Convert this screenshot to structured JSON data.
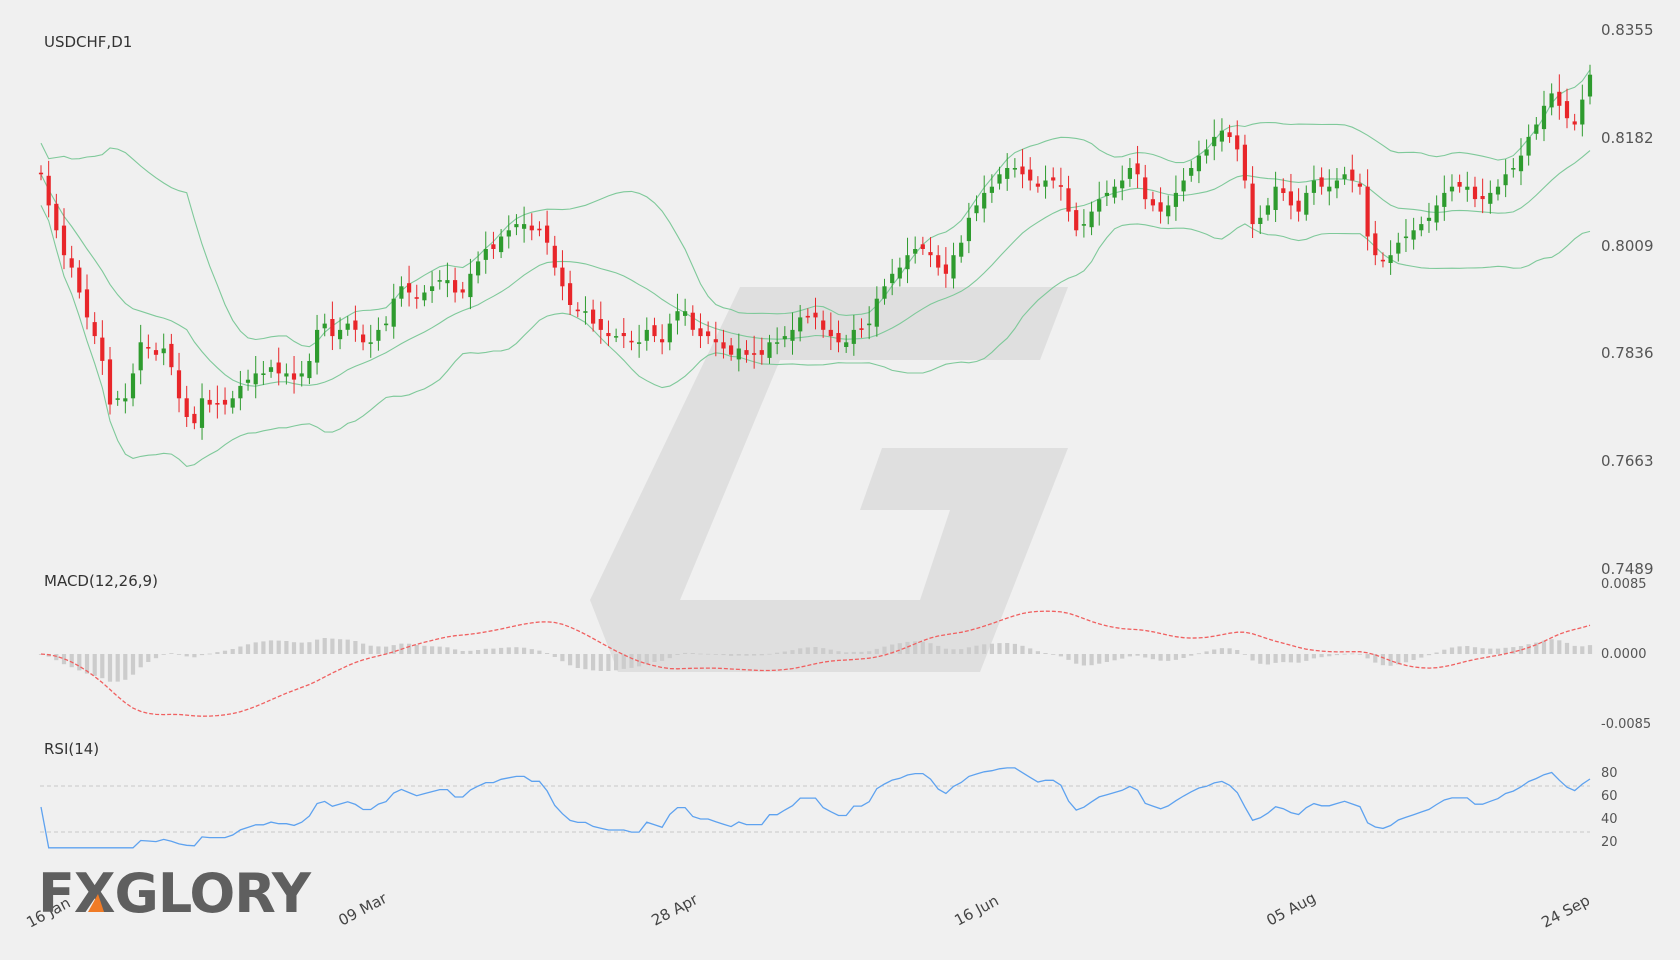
{
  "colors": {
    "bull": "#2e9b2e",
    "bear": "#e8262a",
    "bollinger": "#7fc99a",
    "macd_signal": "#f06060",
    "macd_hist": "#cccccc",
    "rsi": "#5ea2ef",
    "watermark": "#dcdcdc",
    "logo": "#5f5f5f",
    "logo_accent": "#f07b26"
  },
  "main_panel": {
    "title": "USDCHF,D1",
    "price_axis": [
      "0.8355",
      "0.8182",
      "0.8009",
      "0.7836",
      "0.7663",
      "0.7489"
    ],
    "price_range": [
      0.7489,
      0.8355
    ]
  },
  "macd_panel": {
    "title": "MACD(12,26,9)",
    "axis": [
      "0.0085",
      "0.0000",
      "-0.0085"
    ],
    "range": [
      -0.0085,
      0.0085
    ]
  },
  "rsi_panel": {
    "title": "RSI(14)",
    "axis": [
      "80",
      "60",
      "40",
      "20"
    ],
    "levels": [
      70,
      30
    ],
    "range": [
      20,
      80
    ]
  },
  "date_axis": [
    "16 Jan",
    "09 Mar",
    "28 Apr",
    "16 Jun",
    "05 Aug",
    "24 Sep"
  ],
  "logo": {
    "text": "FXGLORY"
  },
  "chart_data": {
    "type": "candlestick",
    "symbol": "USDCHF",
    "timeframe": "D1",
    "x_ticks": [
      "16 Jan",
      "09 Mar",
      "28 Apr",
      "16 Jun",
      "05 Aug",
      "24 Sep"
    ],
    "close": [
      0.812,
      0.807,
      0.803,
      0.799,
      0.797,
      0.793,
      0.789,
      0.786,
      0.782,
      0.775,
      0.776,
      0.776,
      0.78,
      0.785,
      0.784,
      0.783,
      0.784,
      0.781,
      0.776,
      0.773,
      0.772,
      0.776,
      0.775,
      0.775,
      0.775,
      0.776,
      0.778,
      0.779,
      0.78,
      0.78,
      0.781,
      0.78,
      0.78,
      0.779,
      0.78,
      0.782,
      0.787,
      0.788,
      0.786,
      0.787,
      0.788,
      0.787,
      0.785,
      0.785,
      0.787,
      0.788,
      0.792,
      0.794,
      0.793,
      0.792,
      0.793,
      0.794,
      0.795,
      0.795,
      0.793,
      0.793,
      0.796,
      0.798,
      0.8,
      0.8,
      0.802,
      0.803,
      0.804,
      0.804,
      0.803,
      0.803,
      0.801,
      0.797,
      0.794,
      0.791,
      0.79,
      0.79,
      0.788,
      0.787,
      0.786,
      0.786,
      0.786,
      0.785,
      0.785,
      0.787,
      0.786,
      0.785,
      0.788,
      0.79,
      0.79,
      0.787,
      0.786,
      0.786,
      0.785,
      0.784,
      0.783,
      0.784,
      0.783,
      0.783,
      0.783,
      0.785,
      0.785,
      0.786,
      0.787,
      0.789,
      0.789,
      0.789,
      0.787,
      0.786,
      0.785,
      0.785,
      0.787,
      0.787,
      0.788,
      0.792,
      0.794,
      0.796,
      0.797,
      0.799,
      0.8,
      0.8,
      0.799,
      0.797,
      0.796,
      0.799,
      0.801,
      0.805,
      0.807,
      0.809,
      0.81,
      0.812,
      0.813,
      0.813,
      0.812,
      0.811,
      0.81,
      0.811,
      0.811,
      0.81,
      0.806,
      0.803,
      0.804,
      0.806,
      0.808,
      0.809,
      0.81,
      0.811,
      0.813,
      0.812,
      0.808,
      0.807,
      0.806,
      0.807,
      0.809,
      0.811,
      0.813,
      0.815,
      0.816,
      0.818,
      0.819,
      0.818,
      0.816,
      0.811,
      0.804,
      0.805,
      0.807,
      0.81,
      0.809,
      0.807,
      0.806,
      0.809,
      0.811,
      0.81,
      0.81,
      0.811,
      0.812,
      0.811,
      0.81,
      0.802,
      0.799,
      0.798,
      0.799,
      0.801,
      0.802,
      0.803,
      0.804,
      0.805,
      0.807,
      0.809,
      0.81,
      0.81,
      0.81,
      0.808,
      0.808,
      0.809,
      0.81,
      0.812,
      0.813,
      0.815,
      0.818,
      0.82,
      0.823,
      0.825,
      0.823,
      0.821,
      0.82,
      0.824,
      0.828
    ]
  }
}
